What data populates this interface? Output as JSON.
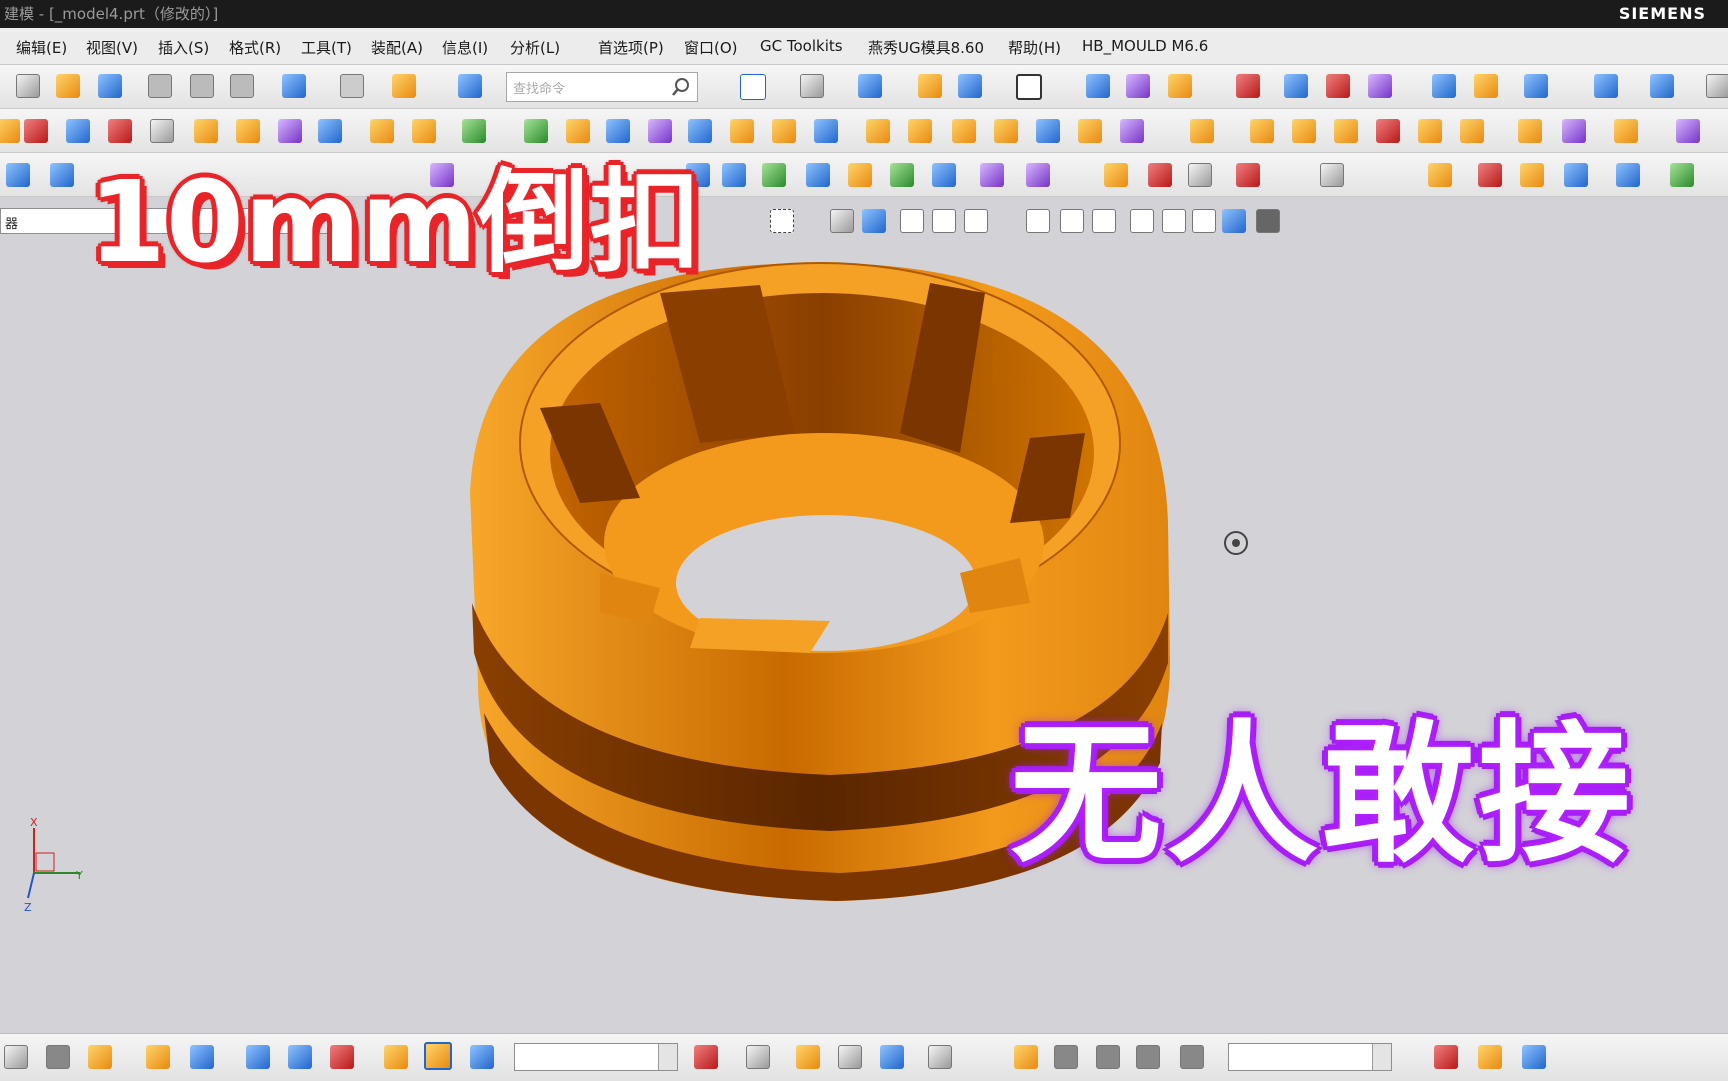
{
  "window": {
    "title": "建模 - [_model4.prt（修改的）]",
    "brand": "SIEMENS"
  },
  "menu": {
    "items": [
      "编辑(E)",
      "视图(V)",
      "插入(S)",
      "格式(R)",
      "工具(T)",
      "装配(A)",
      "信息(I)",
      "分析(L)",
      "首选项(P)",
      "窗口(O)",
      "GC Toolkits",
      "燕秀UG模具8.60",
      "帮助(H)",
      "HB_MOULD M6.6"
    ]
  },
  "toolbar": {
    "search_placeholder": "查找命令"
  },
  "selection_bar": {
    "filter_value": "器"
  },
  "overlay": {
    "headline": "10mm倒扣",
    "tagline": "无人敢接",
    "headline_outline_color": "#e8262a",
    "tagline_glow_color": "#a020f0"
  },
  "model": {
    "color": "#f39a1c",
    "shade_color": "#8a3f00"
  },
  "triad": {
    "x_label": "X",
    "y_label": "Y",
    "z_label": "Z"
  }
}
